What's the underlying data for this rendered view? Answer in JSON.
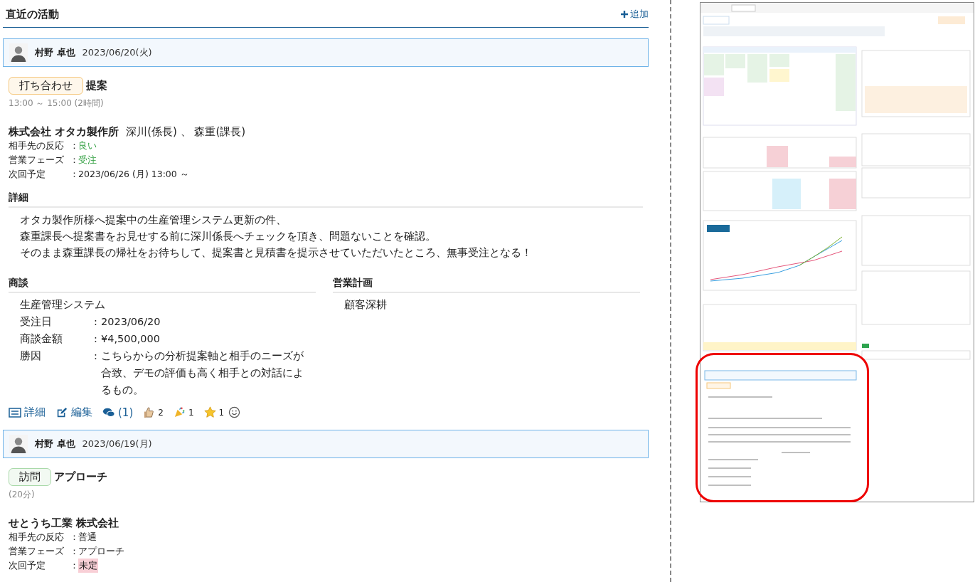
{
  "section": {
    "title": "直近の活動",
    "add_label": "追加"
  },
  "activities": [
    {
      "author": "村野 卓也",
      "date": "2023/06/20(火)",
      "type_label": "打ち合わせ",
      "color": "#f5c67a",
      "title": "提案",
      "time": "13:00 ～ 15:00 (2時間)",
      "company": "株式会社 オタカ製作所",
      "contacts": "深川(係長) 、 森重(課長)",
      "fields": [
        {
          "label": "相手先の反応",
          "sep": "：",
          "value": "良い",
          "kind": "positive"
        },
        {
          "label": "営業フェーズ",
          "sep": "：",
          "value": "受注",
          "kind": "positive"
        },
        {
          "label": "次回予定",
          "sep": "：",
          "value": "2023/06/26 (月) 13:00 ～",
          "kind": "plain"
        }
      ],
      "details_heading": "詳細",
      "details_lines": [
        "オタカ製作所様へ提案中の生産管理システム更新の件、",
        "森重課長へ提案書をお見せする前に深川係長へチェックを頂き、問題ないことを確認。",
        "そのまま森重課長の帰社をお待ちして、提案書と見積書を提示させていただいたところ、無事受注となる！"
      ],
      "deal": {
        "heading": "商談",
        "name": "生産管理システム",
        "rows": [
          {
            "label": "受注日",
            "sep": ":",
            "value": "2023/06/20"
          },
          {
            "label": "商談金額",
            "sep": ":",
            "value": "¥4,500,000"
          },
          {
            "label": "勝因",
            "sep": ":",
            "value": "こちらからの分析提案軸と相手のニーズが合致、デモの評価も高く相手との対話によるもの。"
          }
        ]
      },
      "plan": {
        "heading": "営業計画",
        "value": "顧客深耕"
      },
      "actions": {
        "detail": "詳細",
        "edit": "編集",
        "comments": "(1)",
        "reactions": [
          {
            "kind": "thumbs",
            "count": "2"
          },
          {
            "kind": "party",
            "count": "1"
          },
          {
            "kind": "star",
            "count": "1"
          }
        ]
      }
    },
    {
      "author": "村野 卓也",
      "date": "2023/06/19(月)",
      "type_label": "訪問",
      "color": "#a9d9a9",
      "title": "アプローチ",
      "time": "(20分)",
      "company": "せとうち工業 株式会社",
      "fields": [
        {
          "label": "相手先の反応",
          "sep": "：",
          "value": "普通",
          "kind": "plain"
        },
        {
          "label": "営業フェーズ",
          "sep": "：",
          "value": "アプローチ",
          "kind": "plain"
        },
        {
          "label": "次回予定",
          "sep": "：",
          "value": "未定",
          "kind": "warning"
        }
      ]
    }
  ]
}
